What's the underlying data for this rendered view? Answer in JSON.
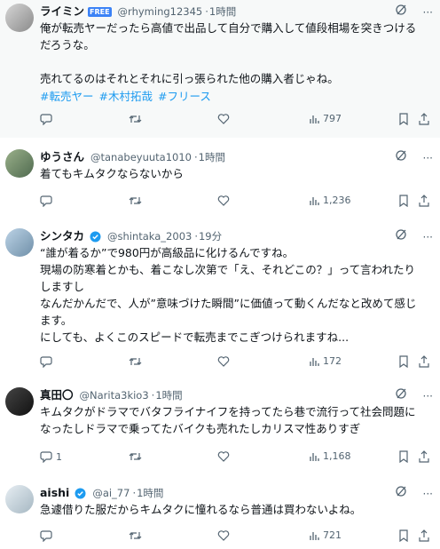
{
  "tweets": [
    {
      "name": "ライミン",
      "badge": "FREE",
      "handle": "@rhyming12345",
      "time": "1時間",
      "lines": [
        "俺が転売ヤーだったら高値で出品して自分で購入して値段相場を突きつける",
        "だろうな。",
        "",
        "売れてるのはそれとそれに引っ張られた他の購入者じゃね。"
      ],
      "tags": [
        "#転売ヤー",
        "#木村拓哉",
        "#フリース"
      ],
      "reply_count": "",
      "views": "797"
    },
    {
      "name": "ゆうさん",
      "handle": "@tanabeyuuta1010",
      "time": "1時間",
      "lines": [
        "着てもキムタクならないから"
      ],
      "reply_count": "",
      "views": "1,236"
    },
    {
      "name": "シンタカ",
      "verified": true,
      "handle": "@shintaka_2003",
      "time": "19分",
      "lines": [
        "“誰が着るか”で980円が高級品に化けるんですね。",
        "現場の防寒着とかも、着こなし次第で「え、それどこの？」って言われたり",
        "しますし",
        "なんだかんだで、人が”意味づけた瞬間”に価値って動くんだなと改めて感じ",
        "ます。",
        "にしても、よくこのスピードで転売までこぎつけられますね..."
      ],
      "reply_count": "",
      "views": "172"
    },
    {
      "name": "真田〇",
      "handle": "@Narita3kio3",
      "time": "1時間",
      "lines": [
        "キムタクがドラマでバタフライナイフを持ってたら巷で流行って社会問題に",
        "なったしドラマで乗ってたバイクも売れたしカリスマ性ありすぎ"
      ],
      "reply_count": "1",
      "views": "1,168"
    },
    {
      "name": "aishi",
      "verified": true,
      "handle": "@ai_77",
      "time": "1時間",
      "lines": [
        "急遽借りた服だからキムタクに憧れるなら普通は買わないよね。"
      ],
      "reply_count": "",
      "views": "721"
    }
  ],
  "colors": {
    "link": "#1d9bf0",
    "verified": "#1d9bf0",
    "muted": "#536471",
    "text": "#0f1419"
  },
  "icons": [
    "grok-icon",
    "more-icon",
    "reply-icon",
    "retweet-icon",
    "like-icon",
    "views-icon",
    "bookmark-icon",
    "share-icon",
    "verified-badge-icon"
  ]
}
